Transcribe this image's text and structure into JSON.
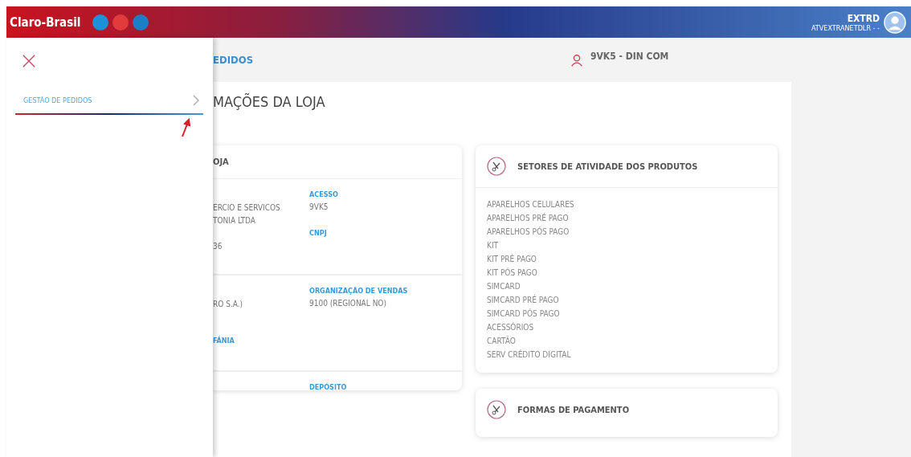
{
  "header": {
    "logo": "Claro-Brasil",
    "user_name": "EXTRD",
    "user_login": "ATVEXTRANETDLR - -"
  },
  "drawer": {
    "items": [
      {
        "label": "GESTÃO DE PEDIDOS",
        "selected": true
      }
    ]
  },
  "breadcrumb": "EDIDOS",
  "store_user": "9VK5 - DIN COM",
  "page_title": "MAÇÕES DA LOJA",
  "store_card": {
    "title": "OJA",
    "sections": [
      [
        {
          "left": {
            "lines": [
              "ERCIO E SERVICOS",
              "TONIA LTDA"
            ]
          },
          "right": {
            "label": "ACESSO",
            "lines": [
              "9VK5"
            ]
          }
        },
        {
          "left": {
            "lines": [
              "36"
            ]
          },
          "right": {
            "label": "CNPJ"
          }
        }
      ],
      [
        {
          "left": {
            "lines": [
              "RO S.A.)"
            ]
          },
          "right": {
            "label": "ORGANIZAÇÃO DE VENDAS",
            "lines": [
              "9100 (REGIONAL NO)"
            ]
          }
        },
        {
          "left": {
            "label": "FÁNIA"
          }
        }
      ],
      [
        {
          "right": {
            "label": "DEPÓSITO"
          }
        }
      ]
    ]
  },
  "sectors_card": {
    "title": "SETORES DE ATIVIDADE DOS PRODUTOS",
    "items": [
      "APARELHOS CELULARES",
      "APARELHOS PRÉ PAGO",
      "APARELHOS PÓS PAGO",
      "KIT",
      "KIT PRÉ PAGO",
      "KIT PÓS PAGO",
      "SIMCARD",
      "SIMCARD PRÉ PAGO",
      "SIMCARD PÓS PAGO",
      "ACESSÓRIOS",
      "CARTÃO",
      "SERV CRÉDITO DIGITAL"
    ]
  },
  "payment_card": {
    "title": "FORMAS DE PAGAMENTO"
  }
}
